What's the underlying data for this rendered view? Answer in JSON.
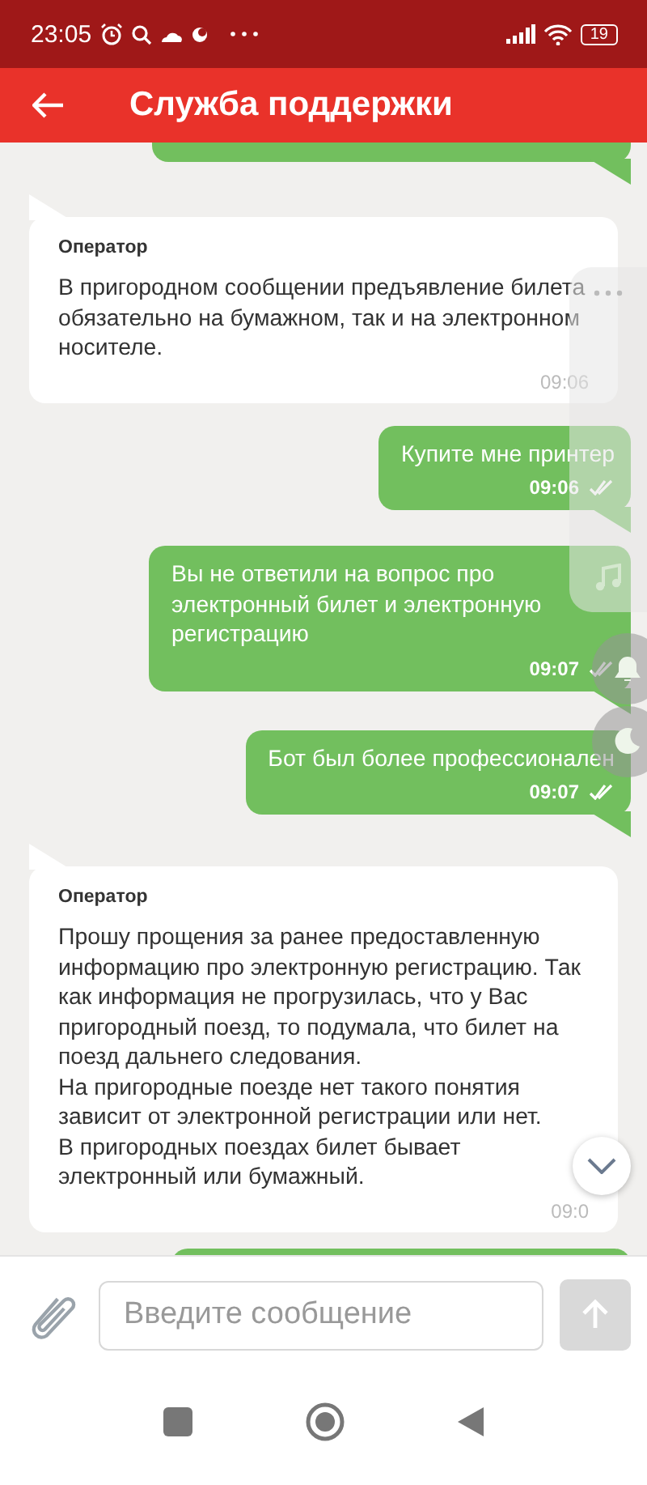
{
  "status_bar": {
    "time": "23:05",
    "battery": "19"
  },
  "header": {
    "title": "Служба поддержки"
  },
  "messages": [
    {
      "kind": "clipped",
      "outgoing": true
    },
    {
      "kind": "text",
      "outgoing": false,
      "sender": "Оператор",
      "text": "В пригородном сообщении предъявление билета обязательно на бумажном, так и на электронном носителе.",
      "time": "09:06"
    },
    {
      "kind": "text",
      "outgoing": true,
      "text": "Купите мне принтер",
      "time": "09:06",
      "read": true
    },
    {
      "kind": "text",
      "outgoing": true,
      "text": "Вы не ответили на вопрос про электронный билет и электронную регистрацию",
      "time": "09:07",
      "read": true
    },
    {
      "kind": "text",
      "outgoing": true,
      "text": "Бот был более профессионален",
      "time": "09:07",
      "read": true
    },
    {
      "kind": "text",
      "outgoing": false,
      "sender": "Оператор",
      "text": "Прошу прощения за ранее предоставленную информацию про электронную регистрацию. Так как информация не прогрузилась, что у Вас пригородный поезд, то подумала, что билет на поезд дальнего следования.\nНа пригородные поезде нет такого понятия зависит от электронной регистрации или нет.\nВ пригородных поездах билет бывает электронный или бумажный.",
      "time": "09:0"
    },
    {
      "kind": "clipped",
      "outgoing": true
    }
  ],
  "composer": {
    "placeholder": "Введите сообщение"
  }
}
